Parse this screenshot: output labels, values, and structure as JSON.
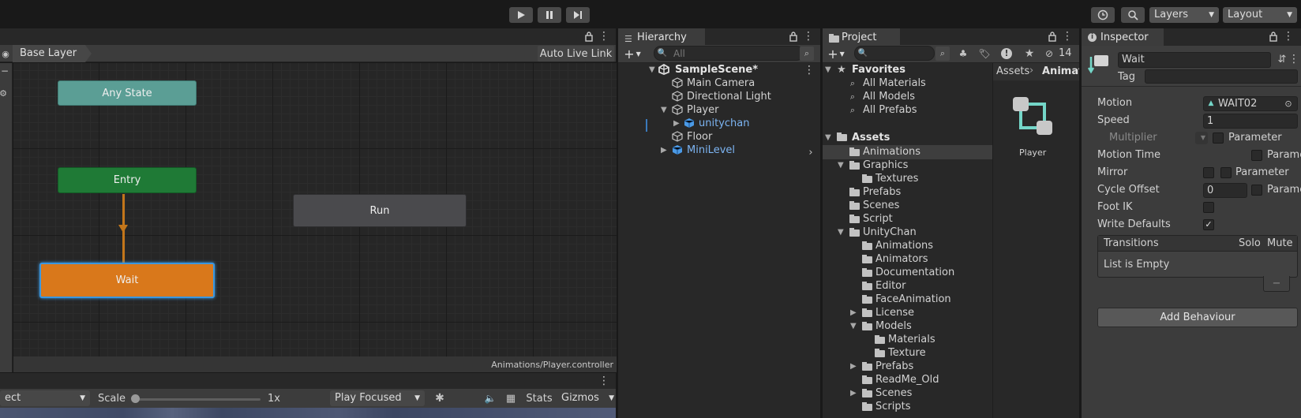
{
  "toolbar": {
    "play_icon": "play-icon",
    "pause_icon": "pause-icon",
    "step_icon": "step-icon",
    "layers_label": "Layers",
    "layout_label": "Layout"
  },
  "animator": {
    "layer_label": "Base Layer",
    "auto_live_link": "Auto Live Link",
    "footer_path": "Animations/Player.controller",
    "nodes": {
      "any_state": "Any State",
      "entry": "Entry",
      "wait": "Wait",
      "run": "Run"
    },
    "colors": {
      "any_state": "#5b9e95",
      "entry": "#1f7a36",
      "wait": "#d9781b",
      "run": "#4a4a4d",
      "transition": "#c3761a"
    }
  },
  "game_toolbar": {
    "display_partial": "ect",
    "scale_label": "Scale",
    "scale_value": "1x",
    "play_mode": "Play Focused",
    "stats": "Stats",
    "gizmos": "Gizmos"
  },
  "hierarchy": {
    "tab": "Hierarchy",
    "search_placeholder": "All",
    "scene": "SampleScene*",
    "items": [
      {
        "label": "Main Camera"
      },
      {
        "label": "Directional Light"
      },
      {
        "label": "Player"
      },
      {
        "label": "unitychan"
      },
      {
        "label": "Floor"
      },
      {
        "label": "MiniLevel"
      }
    ]
  },
  "project": {
    "tab": "Project",
    "hidden_count": "14",
    "favorites_label": "Favorites",
    "favorites": [
      "All Materials",
      "All Models",
      "All Prefabs"
    ],
    "assets_label": "Assets",
    "tree": [
      "Animations",
      "Graphics",
      "Textures",
      "Prefabs",
      "Scenes",
      "Script",
      "UnityChan",
      "Animations",
      "Animators",
      "Documentation",
      "Editor",
      "FaceAnimation",
      "License",
      "Models",
      "Materials",
      "Texture",
      "Prefabs",
      "ReadMe_Old",
      "Scenes",
      "Scripts"
    ],
    "breadcrumb": [
      "Assets",
      "Animat"
    ],
    "asset_name": "Player"
  },
  "inspector": {
    "tab": "Inspector",
    "name_value": "Wait",
    "tag_label": "Tag",
    "motion_label": "Motion",
    "motion_value": "WAIT02",
    "speed_label": "Speed",
    "speed_value": "1",
    "multiplier_label": "Multiplier",
    "parameter": "Parameter",
    "parameter_cut": "Parame",
    "motion_time_label": "Motion Time",
    "mirror_label": "Mirror",
    "cycle_offset_label": "Cycle Offset",
    "cycle_offset_value": "0",
    "foot_ik_label": "Foot IK",
    "write_defaults_label": "Write Defaults",
    "transitions_label": "Transitions",
    "solo_label": "Solo",
    "mute_label": "Mute",
    "list_empty": "List is Empty",
    "remove_label": "−",
    "add_behaviour": "Add Behaviour"
  }
}
